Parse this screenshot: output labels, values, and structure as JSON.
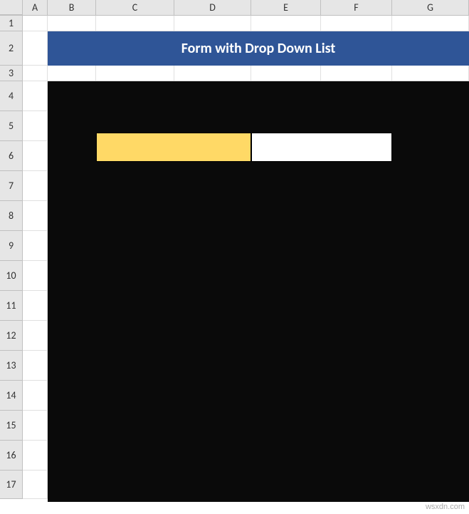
{
  "columns": [
    "A",
    "B",
    "C",
    "D",
    "E",
    "F",
    "G"
  ],
  "rows": [
    "1",
    "2",
    "3",
    "4",
    "5",
    "6",
    "7",
    "8",
    "9",
    "10",
    "11",
    "12",
    "13",
    "14",
    "15",
    "16",
    "17"
  ],
  "title": "Form with Drop Down List",
  "form": {
    "label_cell_value": "",
    "input_cell_value": ""
  },
  "colors": {
    "banner_bg": "#2f5597",
    "banner_text": "#ffffff",
    "form_bg": "#0a0a0a",
    "label_bg": "#ffd966",
    "input_bg": "#ffffff"
  },
  "watermark": "wsxdn.com"
}
